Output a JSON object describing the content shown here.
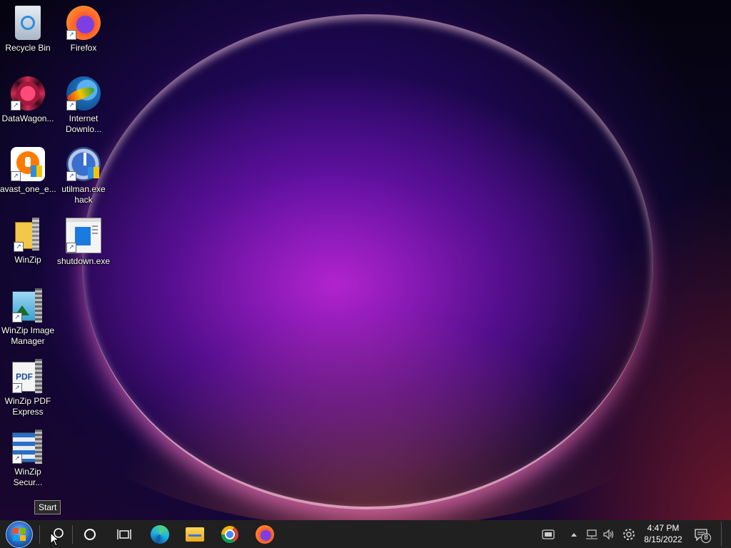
{
  "desktop": {
    "icons": [
      {
        "label": "Recycle Bin",
        "icon": "recycle-bin-icon"
      },
      {
        "label": "Firefox",
        "icon": "firefox-icon"
      },
      {
        "label": "DataWagon...",
        "icon": "datawagon-icon"
      },
      {
        "label": "Internet Downlo...",
        "icon": "internet-download-manager-icon"
      },
      {
        "label": "avast_one_e...",
        "icon": "avast-icon"
      },
      {
        "label": "utilman.exe hack",
        "icon": "utilman-icon"
      },
      {
        "label": "WinZip",
        "icon": "winzip-icon"
      },
      {
        "label": "shutdown.exe",
        "icon": "shutdown-exe-icon"
      },
      {
        "label": "WinZip Image Manager",
        "icon": "winzip-image-manager-icon"
      },
      {
        "label": "WinZip PDF Express",
        "icon": "winzip-pdf-express-icon"
      },
      {
        "label": "WinZip Secur...",
        "icon": "winzip-secure-icon"
      }
    ]
  },
  "tooltip": {
    "text": "Start"
  },
  "taskbar": {
    "start": "start-button",
    "pinned": [
      "search-icon",
      "cortana-icon",
      "task-view-icon",
      "edge-icon",
      "file-explorer-icon",
      "chrome-icon",
      "firefox-icon"
    ],
    "tray": [
      "meet-now-icon",
      "show-hidden-icons-icon",
      "network-icon",
      "volume-icon",
      "settings-icon"
    ],
    "clock": {
      "time": "4:47 PM",
      "date": "8/15/2022"
    },
    "notifications": {
      "count": "8"
    }
  }
}
